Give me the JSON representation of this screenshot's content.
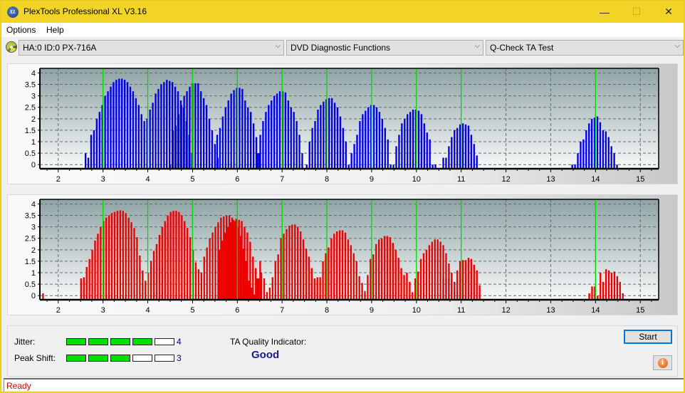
{
  "window": {
    "title": "PlexTools Professional XL V3.16",
    "icon_label": "XL",
    "controls": {
      "minimize": "—",
      "maximize": "☐",
      "close": "✕"
    }
  },
  "menu": {
    "items": [
      {
        "label": "Options"
      },
      {
        "label": "Help"
      }
    ]
  },
  "toolbar": {
    "drive_select": "HA:0 ID:0  PX-716A",
    "function_select": "DVD Diagnostic Functions",
    "test_select": "Q-Check TA Test",
    "chevron": "⌵"
  },
  "chart_data": [
    {
      "type": "bar",
      "name": "ta-upper",
      "color": "#0000ee",
      "marker_color": "#00dd00",
      "xlim": [
        1.59,
        15.41
      ],
      "ylim": [
        -0.18,
        4.2
      ],
      "x_ticks": [
        2,
        3,
        4,
        5,
        6,
        7,
        8,
        9,
        10,
        11,
        12,
        13,
        14,
        15
      ],
      "y_ticks": [
        {
          "v": 0,
          "label": "0"
        },
        {
          "v": 0.5,
          "label": "0.5"
        },
        {
          "v": 1,
          "label": "1"
        },
        {
          "v": 1.5,
          "label": "1.5"
        },
        {
          "v": 2,
          "label": "2"
        },
        {
          "v": 2.5,
          "label": "2.5"
        },
        {
          "v": 3,
          "label": "3"
        },
        {
          "v": 3.5,
          "label": "3.5"
        },
        {
          "v": 4,
          "label": "4"
        }
      ],
      "markers": [
        3,
        4,
        5,
        6,
        7,
        8,
        9,
        10,
        11,
        14
      ],
      "bar_step": 0.0625,
      "groups": [
        {
          "x0": 2.61,
          "values": [
            0.5,
            0.3,
            1.3,
            1.5,
            2.0,
            2.3,
            2.6,
            3.0,
            3.2,
            3.4,
            3.6,
            3.7,
            3.75,
            3.75,
            3.7,
            3.6,
            3.4,
            3.2,
            2.9,
            2.6,
            2.2,
            1.9,
            2.0
          ]
        },
        {
          "x0": 4.05,
          "values": [
            2.4,
            2.7,
            3.1,
            3.3,
            3.5,
            3.6,
            3.7,
            3.65,
            3.6,
            3.4,
            3.2,
            2.8,
            2.5,
            1.9,
            1.3,
            0.5
          ]
        },
        {
          "x0": 4.5,
          "values": [
            0.0,
            1.5,
            1.7,
            2.2,
            2.6,
            3.0,
            3.2,
            3.4,
            3.55,
            3.55,
            3.55,
            3.2,
            2.9,
            2.6,
            2.0,
            1.5,
            0.9,
            0.3
          ]
        },
        {
          "x0": 5.55,
          "values": [
            1.3,
            1.6,
            2.1,
            2.5,
            2.8,
            3.1,
            3.25,
            3.35,
            3.35,
            3.3,
            2.8,
            2.5,
            2.3,
            1.8,
            1.2,
            0.5
          ]
        },
        {
          "x0": 6.45,
          "values": [
            0.5,
            1.3,
            1.9,
            2.3,
            2.6,
            2.8,
            3.0,
            3.1,
            3.2,
            3.2,
            3.15,
            2.8,
            2.5,
            2.3,
            1.9,
            1.3,
            0.5
          ]
        },
        {
          "x0": 7.55,
          "values": [
            0.0,
            1.0,
            1.6,
            1.9,
            2.4,
            2.6,
            2.75,
            2.85,
            2.9,
            2.9,
            2.7,
            2.5,
            2.1,
            1.6,
            1.0,
            0.0
          ]
        },
        {
          "x0": 8.55,
          "values": [
            0.5,
            0.9,
            1.3,
            1.9,
            2.2,
            2.35,
            2.5,
            2.6,
            2.6,
            2.5,
            2.3,
            2.0,
            1.6,
            1.1,
            0.0,
            0.0
          ]
        },
        {
          "x0": 9.55,
          "values": [
            0.8,
            1.3,
            1.8,
            2.0,
            2.2,
            2.3,
            2.4,
            2.4,
            2.35,
            2.2,
            1.8,
            1.4,
            1.1,
            0.0,
            0.0
          ]
        },
        {
          "x0": 10.6,
          "values": [
            0.3,
            0.3,
            0.8,
            1.2,
            1.5,
            1.6,
            1.75,
            1.8,
            1.75,
            1.7,
            1.3,
            0.9,
            0.4
          ]
        },
        {
          "x0": 13.48,
          "values": [
            0.0,
            0.0,
            0.5,
            1.0,
            1.1,
            1.5,
            1.8,
            2.0,
            2.05,
            2.1,
            1.85,
            1.5,
            1.45,
            1.2,
            0.8,
            0.5,
            0.0
          ]
        }
      ]
    },
    {
      "type": "bar",
      "name": "ta-lower",
      "color": "#ee0000",
      "marker_color": "#00dd00",
      "xlim": [
        1.59,
        15.41
      ],
      "ylim": [
        -0.18,
        4.2
      ],
      "x_ticks": [
        2,
        3,
        4,
        5,
        6,
        7,
        8,
        9,
        10,
        11,
        12,
        13,
        14,
        15
      ],
      "y_ticks": [
        {
          "v": 0,
          "label": "0"
        },
        {
          "v": 0.5,
          "label": "0.5"
        },
        {
          "v": 1,
          "label": "1"
        },
        {
          "v": 1.5,
          "label": "1.5"
        },
        {
          "v": 2,
          "label": "2"
        },
        {
          "v": 2.5,
          "label": "2.5"
        },
        {
          "v": 3,
          "label": "3"
        },
        {
          "v": 3.5,
          "label": "3.5"
        },
        {
          "v": 4,
          "label": "4"
        }
      ],
      "markers": [
        3,
        4,
        5,
        6,
        7,
        8,
        9,
        10,
        11,
        14
      ],
      "bar_step": 0.0625,
      "groups": [
        {
          "x0": 1.66,
          "values": [
            0.1
          ]
        },
        {
          "x0": 2.51,
          "values": [
            0.75,
            0.8,
            1.25,
            1.6,
            2.0,
            2.4,
            2.7,
            3.0,
            3.25,
            3.4,
            3.5,
            3.6,
            3.65,
            3.7,
            3.72,
            3.7,
            3.6,
            3.4,
            3.2,
            2.95,
            2.55,
            1.75,
            1.1,
            0.65,
            1.0,
            1.5,
            1.95,
            2.25,
            2.65,
            3.0,
            3.25,
            3.5,
            3.65,
            3.7,
            3.7,
            3.65,
            3.5,
            3.25,
            2.95,
            2.55,
            2.0,
            1.45,
            1.15,
            1.0,
            1.7,
            2.1,
            2.5,
            2.75,
            3.0,
            3.2,
            3.4,
            3.45,
            3.5,
            3.5,
            3.4,
            3.25,
            3.0,
            2.6,
            2.05,
            1.5,
            0.65,
            0.35,
            0.05,
            0.75,
            1.5
          ]
        },
        {
          "x0": 5.6,
          "values": [
            2.0,
            2.4,
            2.75,
            3.0,
            3.2,
            3.3,
            3.35,
            3.3,
            3.25,
            3.0,
            2.75,
            2.35,
            1.7,
            1.2,
            0.75,
            1.0,
            0.75,
            0.15,
            0.35,
            0.8,
            1.5,
            1.8,
            2.5,
            2.7,
            2.9,
            3.05,
            3.1,
            3.1,
            3.0,
            2.8,
            2.45,
            2.05,
            1.7,
            1.2,
            0.75,
            0.8,
            0.0
          ]
        },
        {
          "x0": 7.85,
          "values": [
            0.8,
            1.5,
            1.85,
            2.1,
            2.5,
            2.7,
            2.8,
            2.85,
            2.85,
            2.75,
            2.45,
            2.2,
            1.85,
            1.5,
            0.85,
            0.55,
            0.2,
            0.9,
            1.6,
            1.8,
            2.25,
            2.45,
            2.5,
            2.6,
            2.6,
            2.55,
            2.3,
            2.0,
            1.65,
            1.2,
            0.9,
            1.0,
            0.6,
            0.15,
            0.75,
            1.05,
            1.6,
            1.85,
            2.0,
            2.2,
            2.35,
            2.45,
            2.45,
            2.35,
            2.2,
            1.85,
            1.4,
            1.0,
            0.3,
            0.15,
            0.15
          ]
        },
        {
          "x0": 10.6,
          "values": [
            0.75,
            0.75,
            0.75,
            1.0,
            0.6,
            1.1,
            1.5,
            1.55,
            1.55,
            1.65,
            1.6,
            1.35,
            1.1,
            0.45
          ]
        },
        {
          "x0": 13.86,
          "values": [
            0.1,
            0.4,
            0.4,
            0.0,
            1.0,
            0.6,
            1.15,
            1.1,
            1.0,
            1.05,
            0.85,
            0.6,
            0.1
          ]
        }
      ]
    }
  ],
  "results": {
    "jitter_label": "Jitter:",
    "jitter_value": "4",
    "jitter_level": 4,
    "peak_shift_label": "Peak Shift:",
    "peak_shift_value": "3",
    "peak_shift_level": 3,
    "meter_max": 5,
    "meter_on_color": "#00e000",
    "ta_quality_label": "TA Quality Indicator:",
    "ta_quality_value": "Good"
  },
  "buttons": {
    "start": "Start",
    "info": "i"
  },
  "status": {
    "text": "Ready"
  }
}
